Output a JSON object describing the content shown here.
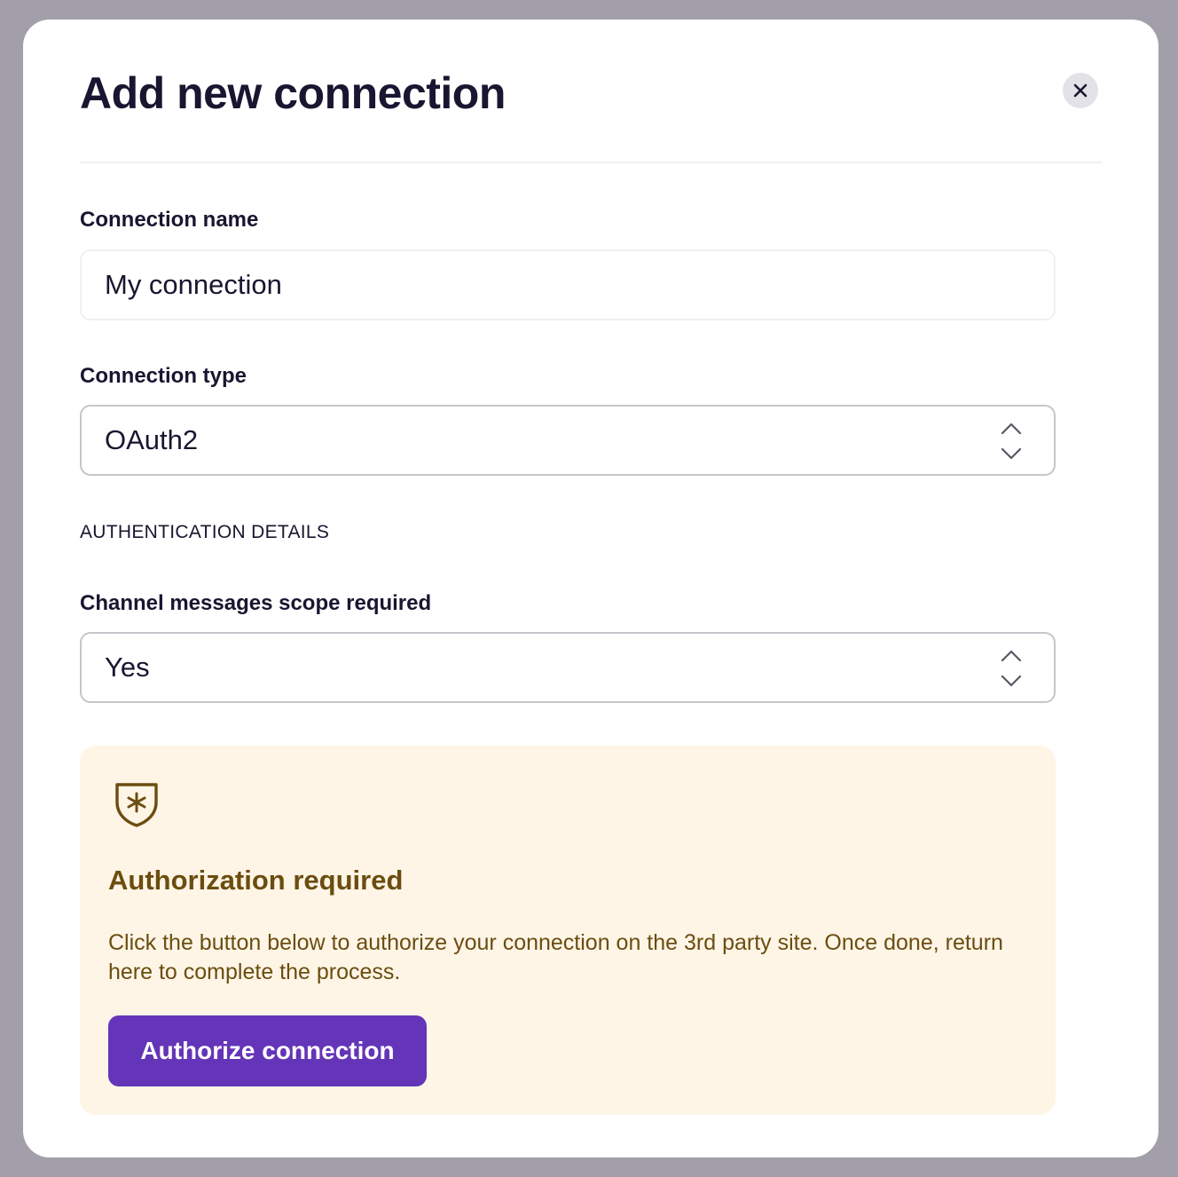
{
  "modal": {
    "title": "Add new connection",
    "close_icon": "close-icon"
  },
  "form": {
    "connection_name": {
      "label": "Connection name",
      "value": "My connection"
    },
    "connection_type": {
      "label": "Connection type",
      "selected": "OAuth2",
      "icon": "chevron-up-down-icon"
    },
    "section_heading": "AUTHENTICATION DETAILS",
    "channel_scope": {
      "label": "Channel messages scope required",
      "selected": "Yes",
      "icon": "chevron-up-down-icon"
    }
  },
  "authorization": {
    "icon": "shield-asterisk-icon",
    "title": "Authorization required",
    "description": "Click the button below to authorize your connection on the 3rd party site. Once done, return here to complete the process.",
    "button_label": "Authorize connection"
  },
  "colors": {
    "overlay": "#a29fab",
    "accent": "#6435b8",
    "notice_bg": "#fef5e6",
    "notice_text": "#6b4d10"
  }
}
